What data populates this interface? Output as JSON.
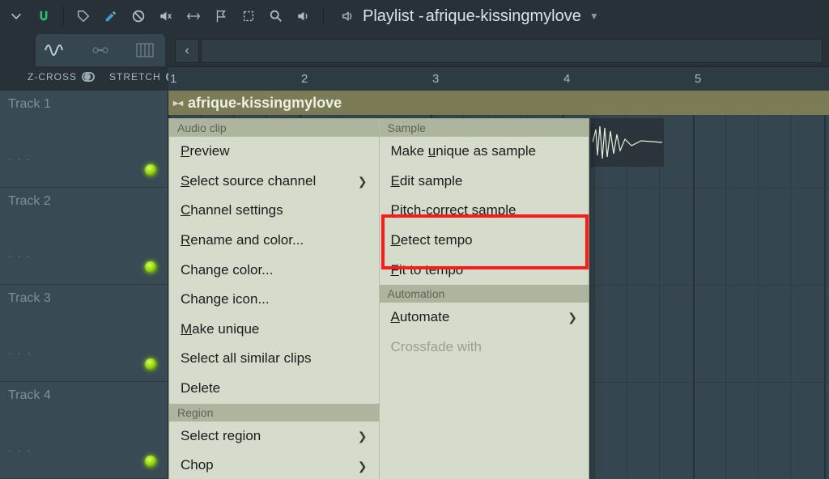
{
  "toolbar": {
    "title_prefix": "Playlist - ",
    "title_file": "afrique-kissingmylove"
  },
  "secbar": {
    "zcross_label": "Z-CROSS",
    "stretch_label": "STRETCH",
    "back_glyph": "‹"
  },
  "ruler": {
    "ticks": [
      "1",
      "2",
      "3",
      "4",
      "5"
    ]
  },
  "tracks": [
    {
      "name": "Track 1"
    },
    {
      "name": "Track 2"
    },
    {
      "name": "Track 3"
    },
    {
      "name": "Track 4"
    }
  ],
  "clip": {
    "name": "afrique-kissingmylove"
  },
  "menu": {
    "left": {
      "group1_header": "Audio clip",
      "items1": [
        {
          "label": "Preview",
          "ul": "P"
        },
        {
          "label": "Select source channel",
          "ul": "S",
          "submenu": true
        },
        {
          "label": "Channel settings",
          "ul": "C"
        },
        {
          "label": "Rename and color...",
          "ul": "R"
        },
        {
          "label": "Change color...",
          "ul": null
        },
        {
          "label": "Change icon...",
          "ul": null
        },
        {
          "label": "Make unique",
          "ul": "M"
        },
        {
          "label": "Select all similar clips",
          "ul": null
        },
        {
          "label": "Delete",
          "ul": null
        }
      ],
      "group2_header": "Region",
      "items2": [
        {
          "label": "Select region",
          "ul": null,
          "submenu": true
        },
        {
          "label": "Chop",
          "ul": null,
          "submenu": true
        }
      ]
    },
    "right": {
      "group1_header": "Sample",
      "items1": [
        {
          "label": "Make unique as sample",
          "ul": "u",
          "ulpos": 5
        },
        {
          "label": "Edit sample",
          "ul": "E"
        },
        {
          "label": "Pitch-correct sample",
          "ul": "P"
        },
        {
          "label": "Detect tempo",
          "ul": "D"
        },
        {
          "label": "Fit to tempo",
          "ul": "F"
        }
      ],
      "group2_header": "Automation",
      "items2": [
        {
          "label": "Automate",
          "ul": "A",
          "submenu": true
        },
        {
          "label": "Crossfade with",
          "disabled": true
        }
      ]
    }
  }
}
